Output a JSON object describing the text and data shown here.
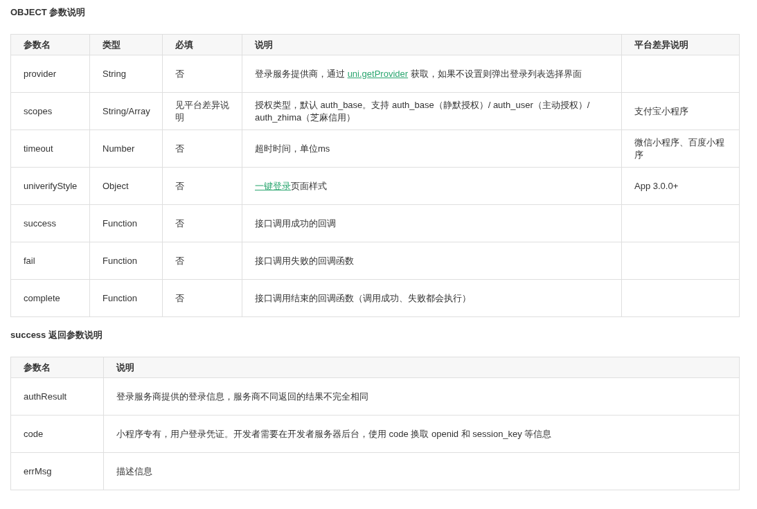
{
  "sections": [
    {
      "title": "OBJECT 参数说明",
      "columns": [
        "参数名",
        "类型",
        "必填",
        "说明",
        "平台差异说明"
      ],
      "rows": [
        {
          "cells": [
            [
              {
                "text": "provider"
              }
            ],
            [
              {
                "text": "String"
              }
            ],
            [
              {
                "text": "否"
              }
            ],
            [
              {
                "text": "登录服务提供商，通过 "
              },
              {
                "text": "uni.getProvider",
                "link": true
              },
              {
                "text": " 获取，如果不设置则弹出登录列表选择界面"
              }
            ],
            []
          ]
        },
        {
          "cells": [
            [
              {
                "text": "scopes"
              }
            ],
            [
              {
                "text": "String/Array"
              }
            ],
            [
              {
                "text": "见平台差异说明"
              }
            ],
            [
              {
                "text": "授权类型，默认 auth_base。支持 auth_base（静默授权）/ auth_user（主动授权）/ auth_zhima（芝麻信用）"
              }
            ],
            [
              {
                "text": "支付宝小程序"
              }
            ]
          ]
        },
        {
          "cells": [
            [
              {
                "text": "timeout"
              }
            ],
            [
              {
                "text": "Number"
              }
            ],
            [
              {
                "text": "否"
              }
            ],
            [
              {
                "text": "超时时间，单位ms"
              }
            ],
            [
              {
                "text": "微信小程序、百度小程序"
              }
            ]
          ]
        },
        {
          "cells": [
            [
              {
                "text": "univerifyStyle"
              }
            ],
            [
              {
                "text": "Object"
              }
            ],
            [
              {
                "text": "否"
              }
            ],
            [
              {
                "text": "一键登录",
                "link": true
              },
              {
                "text": "页面样式"
              }
            ],
            [
              {
                "text": "App 3.0.0+"
              }
            ]
          ]
        },
        {
          "cells": [
            [
              {
                "text": "success"
              }
            ],
            [
              {
                "text": "Function"
              }
            ],
            [
              {
                "text": "否"
              }
            ],
            [
              {
                "text": "接口调用成功的回调"
              }
            ],
            []
          ]
        },
        {
          "cells": [
            [
              {
                "text": "fail"
              }
            ],
            [
              {
                "text": "Function"
              }
            ],
            [
              {
                "text": "否"
              }
            ],
            [
              {
                "text": "接口调用失败的回调函数"
              }
            ],
            []
          ]
        },
        {
          "cells": [
            [
              {
                "text": "complete"
              }
            ],
            [
              {
                "text": "Function"
              }
            ],
            [
              {
                "text": "否"
              }
            ],
            [
              {
                "text": "接口调用结束的回调函数（调用成功、失败都会执行）"
              }
            ],
            []
          ]
        }
      ]
    },
    {
      "title": "success 返回参数说明",
      "columns": [
        "参数名",
        "说明"
      ],
      "rows": [
        {
          "cells": [
            [
              {
                "text": "authResult"
              }
            ],
            [
              {
                "text": "登录服务商提供的登录信息，服务商不同返回的结果不完全相同"
              }
            ]
          ]
        },
        {
          "cells": [
            [
              {
                "text": "code"
              }
            ],
            [
              {
                "text": "小程序专有，用户登录凭证。开发者需要在开发者服务器后台，使用 code 换取 openid 和 session_key 等信息"
              }
            ]
          ]
        },
        {
          "cells": [
            [
              {
                "text": "errMsg"
              }
            ],
            [
              {
                "text": "描述信息"
              }
            ]
          ]
        }
      ]
    }
  ]
}
